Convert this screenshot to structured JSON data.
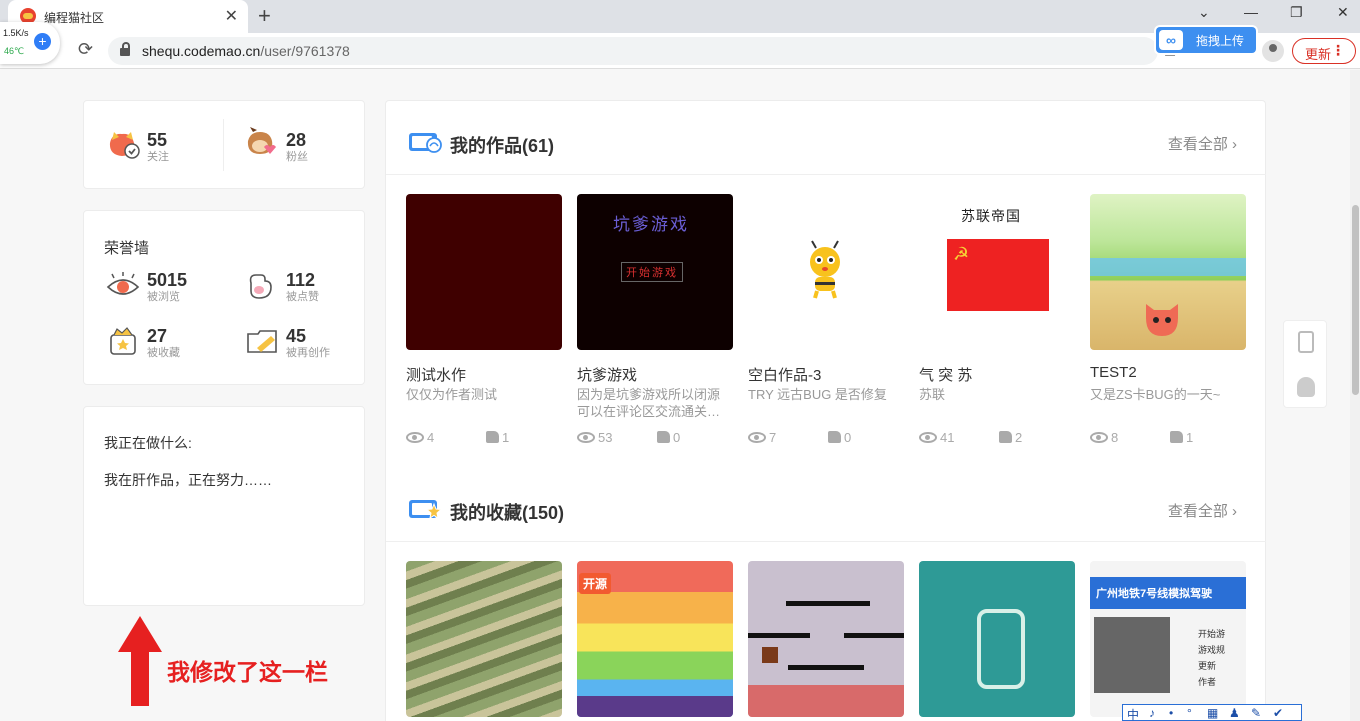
{
  "browser": {
    "tab_title": "编程猫社区",
    "new_tab": "+",
    "url_host": "shequ.codemao.cn",
    "url_path": "/user/9761378",
    "net_speed": "1.5K/s",
    "cpu_temp": "46℃",
    "upload_label": "拖拽上传",
    "update_label": "更新"
  },
  "stats": {
    "follow": {
      "value": "55",
      "label": "关注"
    },
    "fans": {
      "value": "28",
      "label": "粉丝"
    }
  },
  "honor": {
    "title": "荣誉墙",
    "items": [
      {
        "value": "5015",
        "label": "被浏览"
      },
      {
        "value": "112",
        "label": "被点赞"
      },
      {
        "value": "27",
        "label": "被收藏"
      },
      {
        "value": "45",
        "label": "被再创作"
      }
    ]
  },
  "doing": {
    "title": "我正在做什么:",
    "text": "我在肝作品，正在努力……"
  },
  "works_section": {
    "title": "我的作品(61)",
    "view_all": "查看全部",
    "items": [
      {
        "title": "测试水作",
        "desc": "仅仅为作者测试",
        "views": "4",
        "likes": "1"
      },
      {
        "title": "坑爹游戏",
        "desc": "因为是坑爹游戏所以闭源 可以在评论区交流通关…",
        "views": "53",
        "likes": "0",
        "thumb_text_1": "坑爹游戏",
        "thumb_text_2": "开始游戏"
      },
      {
        "title": "空白作品-3",
        "desc": "TRY 远古BUG 是否修复",
        "views": "7",
        "likes": "0"
      },
      {
        "title": "气 突 苏",
        "desc": "苏联",
        "views": "41",
        "likes": "2",
        "thumb_text_1": "苏联帝国"
      },
      {
        "title": "TEST2",
        "desc": "又是ZS卡BUG的一天~",
        "views": "8",
        "likes": "1"
      }
    ]
  },
  "fav_section": {
    "title": "我的收藏(150)",
    "view_all": "查看全部",
    "thumb_texts": {
      "open_source": "开源",
      "metro": "广州地铁7号线模拟驾驶",
      "menu_1": "开始游",
      "menu_2": "游戏规",
      "menu_3": "更新",
      "menu_4": "作者"
    }
  },
  "annotation": "我修改了这一栏",
  "ime": [
    "中",
    "♪",
    "•",
    "°",
    "▦",
    "♟",
    "✎",
    "✔"
  ],
  "colors": {
    "accent": "#3d8ff0",
    "annotation_red": "#e62020",
    "update_red": "#d93025"
  }
}
